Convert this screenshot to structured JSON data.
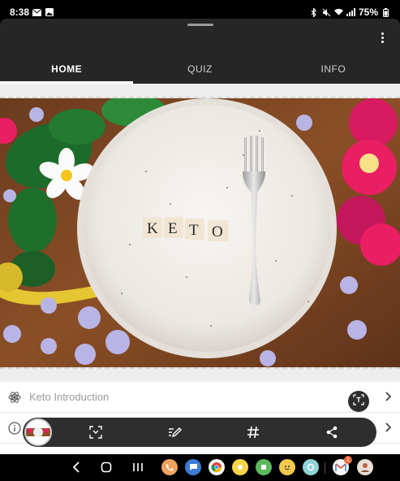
{
  "status": {
    "time": "8:38",
    "battery": "75%"
  },
  "tabs": [
    {
      "label": "HOME",
      "active": true
    },
    {
      "label": "QUIZ",
      "active": false
    },
    {
      "label": "INFO",
      "active": false
    }
  ],
  "banner": {
    "tiles": [
      "K",
      "E",
      "T",
      "O"
    ]
  },
  "list": [
    {
      "label": "Keto Introduction",
      "icon": "atom-icon"
    },
    {
      "label": "",
      "icon": "info-icon"
    }
  ],
  "toolbar": {
    "icons": [
      "scan-icon",
      "edit-icon",
      "hashtag-icon",
      "share-icon"
    ]
  },
  "nav": {
    "apps": [
      {
        "name": "phone-app",
        "color": "#f0a35e"
      },
      {
        "name": "messages-app",
        "color": "#3d7bd8"
      },
      {
        "name": "chrome-app",
        "color": "#f5f5f5"
      },
      {
        "name": "yellow-app",
        "color": "#f7d54a"
      },
      {
        "name": "green-app",
        "color": "#5cb85c"
      },
      {
        "name": "emoji-app",
        "color": "#f2c94c"
      },
      {
        "name": "teal-app",
        "color": "#8fd3d8"
      },
      {
        "name": "gmail-app",
        "color": "#f5f5f5"
      },
      {
        "name": "avatar-app",
        "color": "#e8e0d8"
      }
    ],
    "gmail_badge": "1"
  },
  "colors": {
    "appbar": "#262626",
    "toolbar": "#2e2e2e"
  }
}
